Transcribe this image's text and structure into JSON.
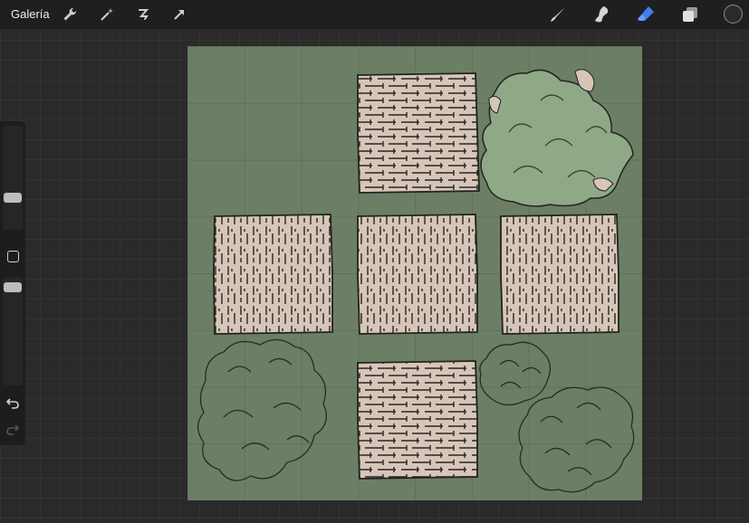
{
  "topbar": {
    "gallery_label": "Galería",
    "left_tools": [
      "wrench-icon",
      "magic-wand-icon",
      "selection-icon",
      "transform-arrow-icon"
    ],
    "right_tools": [
      "brush-icon",
      "smudge-icon",
      "eraser-icon",
      "layers-icon",
      "color-swatch"
    ],
    "active_tool": "eraser-icon",
    "accent": "#3f7df2",
    "current_color": "#2a2a2a"
  },
  "sidebar": {
    "size_slider_level": 0.68,
    "opacity_slider_level": 0.9,
    "icons": [
      "modify-button",
      "undo-icon",
      "redo-icon"
    ]
  },
  "canvas": {
    "background": "#6c7f65",
    "tile_fill": "#d6c6b9",
    "bush_fill": "#8fa886",
    "tiles": [
      "brick-tile",
      "brick-tile",
      "plank-tile",
      "brick-tile",
      "plank-tile",
      "brick-tile"
    ],
    "bushes": [
      "filled-bush",
      "outline-bush",
      "outline-bush",
      "outline-bush"
    ]
  }
}
